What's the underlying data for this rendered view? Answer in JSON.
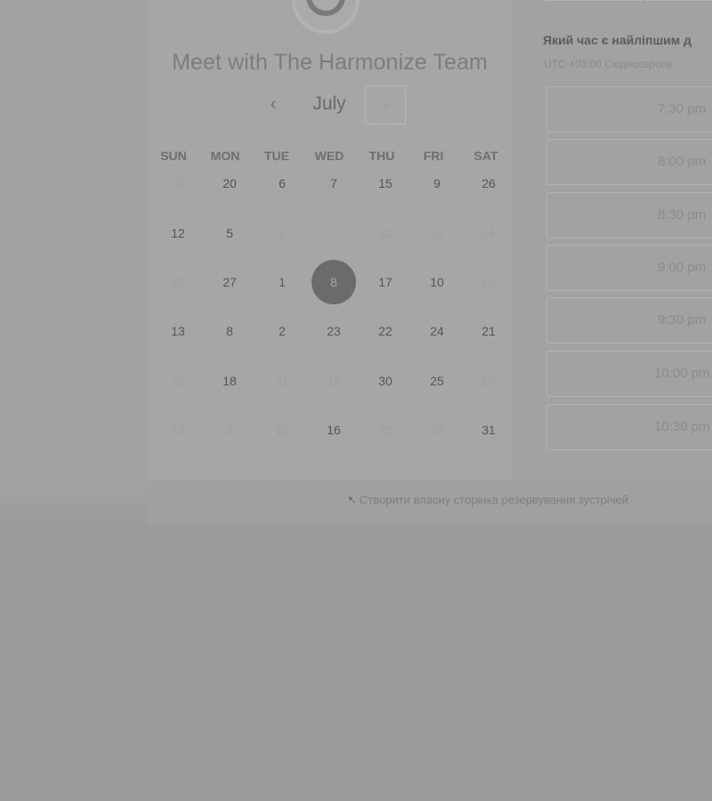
{
  "header": {
    "title": "Meet with The Harmonize Team"
  },
  "calendar": {
    "month": "July",
    "prev_icon": "‹",
    "next_icon": "›",
    "weekdays": [
      "SUN",
      "MON",
      "TUE",
      "WED",
      "THU",
      "FRI",
      "SAT"
    ],
    "weeks": [
      [
        {
          "d": "2",
          "on": false
        },
        {
          "d": "20",
          "on": true
        },
        {
          "d": "6",
          "on": true
        },
        {
          "d": "7",
          "on": true
        },
        {
          "d": "15",
          "on": true
        },
        {
          "d": "9",
          "on": true
        },
        {
          "d": "26",
          "on": true
        }
      ],
      [
        {
          "d": "12",
          "on": true
        },
        {
          "d": "5",
          "on": true
        },
        {
          "d": "6",
          "on": false
        },
        {
          "d": "7",
          "on": false
        },
        {
          "d": "30",
          "on": false
        },
        {
          "d": "14",
          "on": false
        },
        {
          "d": "14",
          "on": false
        }
      ],
      [
        {
          "d": "20",
          "on": false
        },
        {
          "d": "27",
          "on": true
        },
        {
          "d": "1",
          "on": true
        },
        {
          "d": "8",
          "on": true,
          "selected": true
        },
        {
          "d": "17",
          "on": true
        },
        {
          "d": "10",
          "on": true
        },
        {
          "d": "15",
          "on": false
        }
      ],
      [
        {
          "d": "13",
          "on": true
        },
        {
          "d": "8",
          "on": true
        },
        {
          "d": "2",
          "on": true
        },
        {
          "d": "23",
          "on": true
        },
        {
          "d": "22",
          "on": true
        },
        {
          "d": "24",
          "on": true
        },
        {
          "d": "21",
          "on": true
        }
      ],
      [
        {
          "d": "20",
          "on": false
        },
        {
          "d": "18",
          "on": true
        },
        {
          "d": "21",
          "on": false
        },
        {
          "d": "15",
          "on": false
        },
        {
          "d": "30",
          "on": true
        },
        {
          "d": "25",
          "on": true
        },
        {
          "d": "16",
          "on": false
        }
      ],
      [
        {
          "d": "19",
          "on": false
        },
        {
          "d": "5",
          "on": false
        },
        {
          "d": "16",
          "on": false
        },
        {
          "d": "16",
          "on": true
        },
        {
          "d": "25",
          "on": false
        },
        {
          "d": "23",
          "on": false
        },
        {
          "d": "31",
          "on": true
        }
      ]
    ]
  },
  "times": {
    "heading": "Який час є найліпшим д",
    "timezone": "UTC +03:00 Східноєвропе",
    "slots": [
      "7:30 pm",
      "8:00 pm",
      "8:30 pm",
      "9:00 pm",
      "9:30 pm",
      "10:00 pm",
      "10:30 pm"
    ]
  },
  "footer": {
    "link_text": "Створити власну сторінка резервування зустрічей"
  },
  "colors": {
    "selected_day": "#6b6b6b",
    "overlay": "#9b9b9b"
  }
}
